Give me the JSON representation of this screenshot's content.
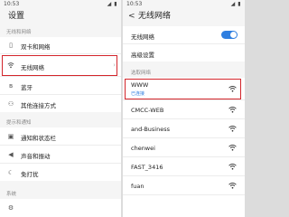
{
  "left": {
    "status": {
      "time": "10:53",
      "signal": "◢ ▮"
    },
    "title": "设置",
    "section_wireless": "无线和网络",
    "items": [
      {
        "label": "双卡和网络"
      },
      {
        "label": "无线网络"
      },
      {
        "label": "蓝牙"
      },
      {
        "label": "其他连接方式"
      }
    ],
    "section_notify": "提示和通知",
    "items2": [
      {
        "label": "通知和状态栏"
      },
      {
        "label": "声音和振动"
      },
      {
        "label": "免打扰"
      }
    ],
    "section_system": "系统"
  },
  "right": {
    "status": {
      "time": "10:53",
      "signal": "◢ ▮"
    },
    "back": "<",
    "title": "无线网络",
    "wifi_toggle_label": "无线网络",
    "wifi_on": true,
    "advanced_label": "高级设置",
    "section_available": "选取网络",
    "connected": {
      "name": "WWW",
      "status": "已连接"
    },
    "networks": [
      "CMCC-WEB",
      "and-Business",
      "chenwei",
      "FAST_3416",
      "fuan"
    ]
  },
  "colors": {
    "highlight": "#d3252b",
    "accent": "#2f7fe0"
  }
}
